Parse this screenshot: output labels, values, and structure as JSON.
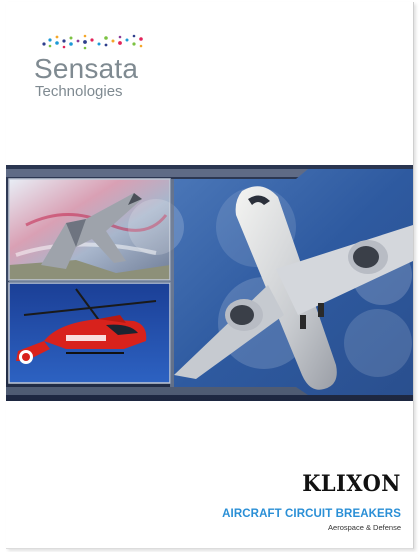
{
  "logo": {
    "name": "Sensata",
    "subtitle": "Technologies",
    "dot_colors": [
      "#2e3e8c",
      "#1e9ad6",
      "#7cc242",
      "#f4a72a",
      "#e2245a",
      "#8d3b97"
    ]
  },
  "cover_text": {
    "brand": "KLIXON",
    "product_title": "AIRCRAFT CIRCUIT BREAKERS",
    "segment": "Aerospace & Defense"
  },
  "photos": [
    {
      "name": "fighter-jet-photo"
    },
    {
      "name": "helicopter-photo"
    },
    {
      "name": "airliner-photo"
    }
  ],
  "colors": {
    "accent_blue": "#2a8fd6",
    "panel_blue": "#2f5da4",
    "band_dark": "#1f2a44",
    "logo_gray": "#7f8a91"
  }
}
